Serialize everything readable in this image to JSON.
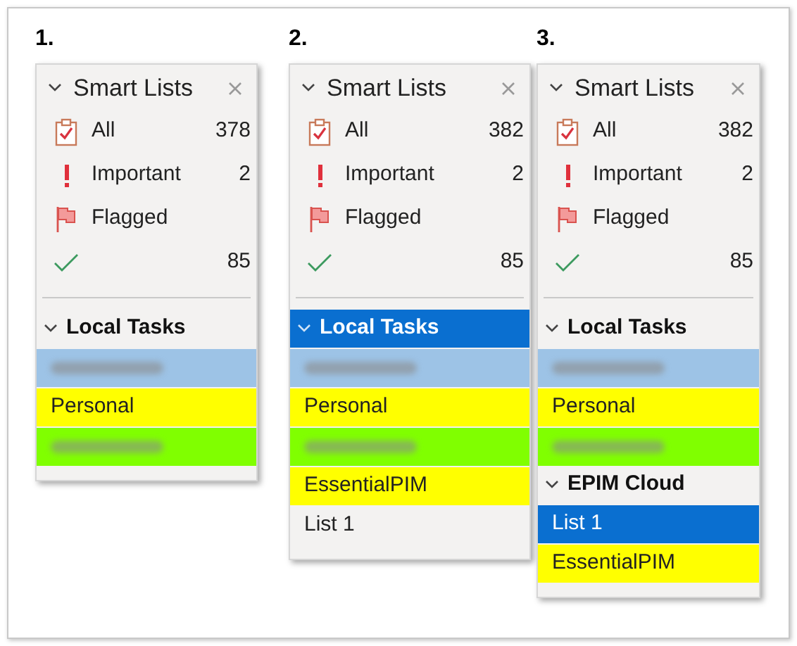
{
  "panels": [
    {
      "number": "1.",
      "smart_lists": {
        "title": "Smart Lists",
        "expanded": true,
        "items": [
          {
            "kind": "all",
            "label": "All",
            "count": "378"
          },
          {
            "kind": "important",
            "label": "Important",
            "count": "2"
          },
          {
            "kind": "flagged",
            "label": "Flagged"
          },
          {
            "kind": "completed",
            "count": "85"
          }
        ]
      },
      "groups": [
        {
          "title": "Local Tasks",
          "expanded": true,
          "selected": false,
          "lists": [
            {
              "kind": "blurred",
              "color": "#9dc3e6",
              "selected": false
            },
            {
              "kind": "text",
              "label": "Personal",
              "color": "#ffff00",
              "selected": false
            },
            {
              "kind": "blurred",
              "color": "#80ff00",
              "selected": false
            }
          ]
        }
      ]
    },
    {
      "number": "2.",
      "smart_lists": {
        "title": "Smart Lists",
        "expanded": true,
        "items": [
          {
            "kind": "all",
            "label": "All",
            "count": "382"
          },
          {
            "kind": "important",
            "label": "Important",
            "count": "2"
          },
          {
            "kind": "flagged",
            "label": "Flagged"
          },
          {
            "kind": "completed",
            "count": "85"
          }
        ]
      },
      "groups": [
        {
          "title": "Local Tasks",
          "expanded": true,
          "selected": true,
          "lists": [
            {
              "kind": "blurred",
              "color": "#9dc3e6",
              "selected": false
            },
            {
              "kind": "text",
              "label": "Personal",
              "color": "#ffff00",
              "selected": false
            },
            {
              "kind": "blurred",
              "color": "#80ff00",
              "selected": false
            },
            {
              "kind": "text",
              "label": "EssentialPIM",
              "color": "#ffff00",
              "selected": false
            },
            {
              "kind": "text",
              "label": "List 1",
              "selected": false
            }
          ]
        }
      ]
    },
    {
      "number": "3.",
      "smart_lists": {
        "title": "Smart Lists",
        "expanded": true,
        "items": [
          {
            "kind": "all",
            "label": "All",
            "count": "382"
          },
          {
            "kind": "important",
            "label": "Important",
            "count": "2"
          },
          {
            "kind": "flagged",
            "label": "Flagged"
          },
          {
            "kind": "completed",
            "count": "85"
          }
        ]
      },
      "groups": [
        {
          "title": "Local Tasks",
          "expanded": true,
          "selected": false,
          "lists": [
            {
              "kind": "blurred",
              "color": "#9dc3e6",
              "selected": false
            },
            {
              "kind": "text",
              "label": "Personal",
              "color": "#ffff00",
              "selected": false
            },
            {
              "kind": "blurred",
              "color": "#80ff00",
              "selected": false
            }
          ]
        },
        {
          "title": "EPIM Cloud",
          "expanded": true,
          "selected": false,
          "lists": [
            {
              "kind": "text",
              "label": "List 1",
              "selected": true
            },
            {
              "kind": "text",
              "label": "EssentialPIM",
              "color": "#ffff00",
              "selected": false
            }
          ]
        }
      ]
    }
  ]
}
